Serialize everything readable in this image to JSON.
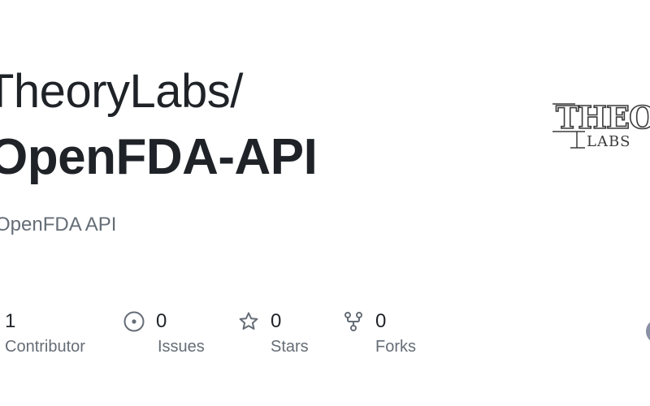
{
  "repo": {
    "owner": "TheoryLabs/",
    "name": "OpenFDA-API",
    "description": "OpenFDA API"
  },
  "logo": {
    "text_main": "THEORY",
    "text_sub": "LABS"
  },
  "stats": {
    "contributors": {
      "count": "1",
      "label": "Contributor",
      "icon": "people-icon"
    },
    "issues": {
      "count": "0",
      "label": "Issues",
      "icon": "issue-opened-icon"
    },
    "stars": {
      "count": "0",
      "label": "Stars",
      "icon": "star-icon"
    },
    "forks": {
      "count": "0",
      "label": "Forks",
      "icon": "repo-forked-icon"
    }
  },
  "colors": {
    "text_primary": "#1f2328",
    "text_muted": "#656d76",
    "avatar": "#8a90a5"
  }
}
